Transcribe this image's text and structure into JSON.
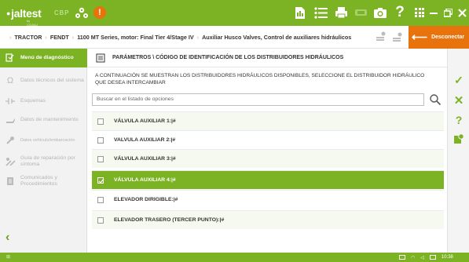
{
  "app": {
    "logo_text": "jaltest",
    "logo_subtext": "by COJALI",
    "product": "CBP"
  },
  "colors": {
    "primary": "#7bb324",
    "accent": "#e8720c"
  },
  "topbar": {
    "icons": [
      "truck-wrench-icon",
      "alert-icon",
      "report-icon",
      "list-icon",
      "printer-icon",
      "vci-icon",
      "camera-icon",
      "help-icon",
      "apps-icon",
      "minimize-icon",
      "restore-icon",
      "close-icon"
    ],
    "help_glyph": "?"
  },
  "breadcrumb": {
    "items": [
      "TRACTOR",
      "FENDT",
      "1100 MT Series, motor: Final Tier 4/Stage IV",
      "Auxiliar Husco Valves, Control de auxiliares hidráulicos"
    ]
  },
  "disconnect_label": "Desconectar",
  "sidebar": {
    "items": [
      {
        "label": "Menú de diagnóstico",
        "icon": "diagnosis-icon",
        "active": true
      },
      {
        "label": "Datos técnicos del sistema",
        "icon": "ohm-icon",
        "active": false
      },
      {
        "label": "Esquemas",
        "icon": "schematic-icon",
        "active": false
      },
      {
        "label": "Datos de mantenimiento",
        "icon": "oilcan-icon",
        "active": false
      },
      {
        "label": "Datos vehículo/embarcación",
        "icon": "wrench-icon",
        "active": false
      },
      {
        "label": "Guía de reparación por síntoma",
        "icon": "repair-guide-icon",
        "active": false
      },
      {
        "label": "Comunicados y Procedimientos",
        "icon": "documents-icon",
        "active": false
      }
    ]
  },
  "main": {
    "title": "PARÁMETROS \\ CÓDIGO DE IDENTIFICACIÓN DE LOS DISTRIBUIDORES HIDRÁULICOS",
    "instructions": "A CONTINUACIÓN SE MUESTRAN LOS DISTRIBUIDORES HIDRÁULICOS DISPONIBLES, SELECCIONE EL DISTRIBUIDOR HIDRÁULICO QUE DESEA INTERCAMBIAR",
    "search_placeholder": "Buscar en el listado de opciones",
    "options": [
      {
        "label": "VÁLVULA AUXILIAR 1:|#",
        "selected": false
      },
      {
        "label": "VALVULA AUXILIAR 2:|#",
        "selected": false
      },
      {
        "label": "VÁLVULA AUXILIAR 3:|#",
        "selected": false
      },
      {
        "label": "VÁLVULA AUXILIAR 4:|#",
        "selected": true
      },
      {
        "label": "ELEVADOR DIRIGIBLE:|#",
        "selected": false
      },
      {
        "label": "ELEVADOR TRASERO (TERCER PUNTO):|#",
        "selected": false
      }
    ]
  },
  "actions": {
    "accept_glyph": "✓",
    "cancel_glyph": "✕",
    "help_glyph": "?"
  },
  "statusbar": {
    "time": "10:38"
  }
}
